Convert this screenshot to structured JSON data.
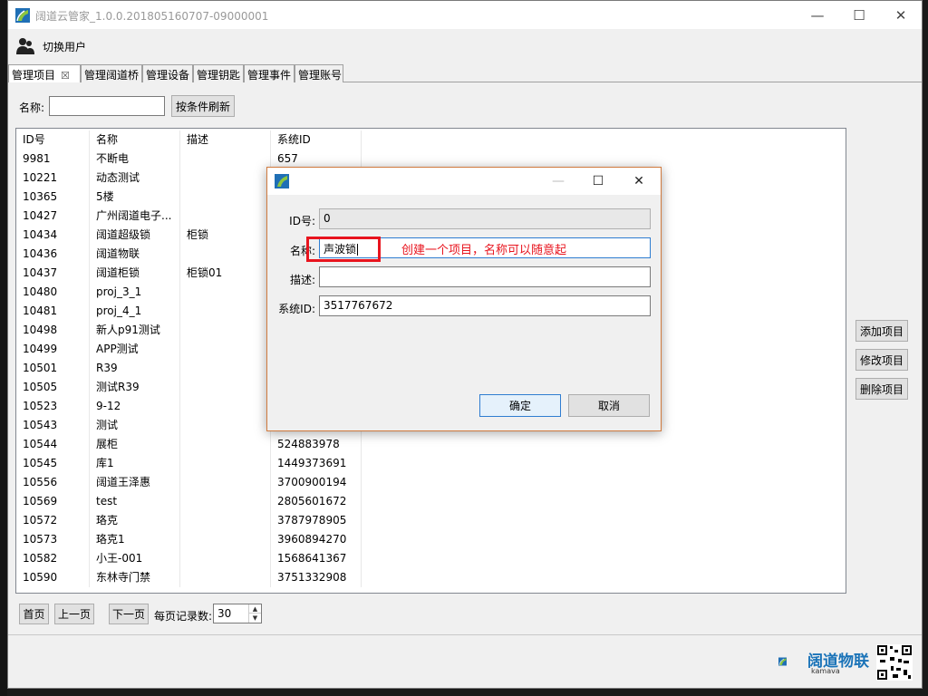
{
  "window": {
    "title": "阔道云管家_1.0.0.201805160707-09000001",
    "minimize": "—",
    "maximize": "☐",
    "close": "✕"
  },
  "toolbar": {
    "switch_user": "切换用户"
  },
  "tabs": [
    {
      "label": "管理项目",
      "close": "☒"
    },
    {
      "label": "管理阔道桥"
    },
    {
      "label": "管理设备"
    },
    {
      "label": "管理钥匙"
    },
    {
      "label": "管理事件"
    },
    {
      "label": "管理账号"
    }
  ],
  "filter": {
    "name_label": "名称:",
    "name_value": "",
    "refresh_button": "按条件刷新"
  },
  "table": {
    "columns": [
      "ID号",
      "名称",
      "描述",
      "系统ID"
    ],
    "rows": [
      [
        "9981",
        "不断电",
        "",
        "657"
      ],
      [
        "10221",
        "动态测试",
        "",
        ""
      ],
      [
        "10365",
        "5楼",
        "",
        ""
      ],
      [
        "10427",
        "广州阔道电子...",
        "",
        ""
      ],
      [
        "10434",
        "阔道超级锁",
        "柜锁",
        ""
      ],
      [
        "10436",
        "阔道物联",
        "",
        ""
      ],
      [
        "10437",
        "阔道柜锁",
        "柜锁01",
        ""
      ],
      [
        "10480",
        "proj_3_1",
        "",
        ""
      ],
      [
        "10481",
        "proj_4_1",
        "",
        ""
      ],
      [
        "10498",
        "新人p91测试",
        "",
        ""
      ],
      [
        "10499",
        "APP测试",
        "",
        ""
      ],
      [
        "10501",
        "R39",
        "",
        ""
      ],
      [
        "10505",
        "测试R39",
        "",
        ""
      ],
      [
        "10523",
        "9-12",
        "",
        ""
      ],
      [
        "10543",
        "测试",
        "",
        ""
      ],
      [
        "10544",
        "展柜",
        "",
        "524883978"
      ],
      [
        "10545",
        "库1",
        "",
        "1449373691"
      ],
      [
        "10556",
        "阔道王泽惠",
        "",
        "3700900194"
      ],
      [
        "10569",
        "test",
        "",
        "2805601672"
      ],
      [
        "10572",
        "珞克",
        "",
        "3787978905"
      ],
      [
        "10573",
        "珞克1",
        "",
        "3960894270"
      ],
      [
        "10582",
        "小王-001",
        "",
        "1568641367"
      ],
      [
        "10590",
        "东林寺门禁",
        "",
        "3751332908"
      ]
    ]
  },
  "side_buttons": {
    "add": "添加项目",
    "edit": "修改项目",
    "delete": "删除项目"
  },
  "pager": {
    "first": "首页",
    "prev": "上一页",
    "next": "下一页",
    "per_page_label": "每页记录数:",
    "per_page_value": "30"
  },
  "brand": {
    "name": "阔道物联",
    "sub": "kamava"
  },
  "dialog": {
    "minimize": "—",
    "maximize": "☐",
    "close": "✕",
    "id_label": "ID号:",
    "id_value": "0",
    "name_label": "名称:",
    "name_value": "声波锁",
    "desc_label": "描述:",
    "desc_value": "",
    "sysid_label": "系统ID:",
    "sysid_value": "3517767672",
    "ok_button": "确定",
    "cancel_button": "取消",
    "annotation": "创建一个项目，名称可以随意起"
  },
  "colors": {
    "accent": "#2f7dd1",
    "annotation": "#e8141e",
    "dialog_border": "#d07a3e",
    "brand": "#1a73b8"
  }
}
